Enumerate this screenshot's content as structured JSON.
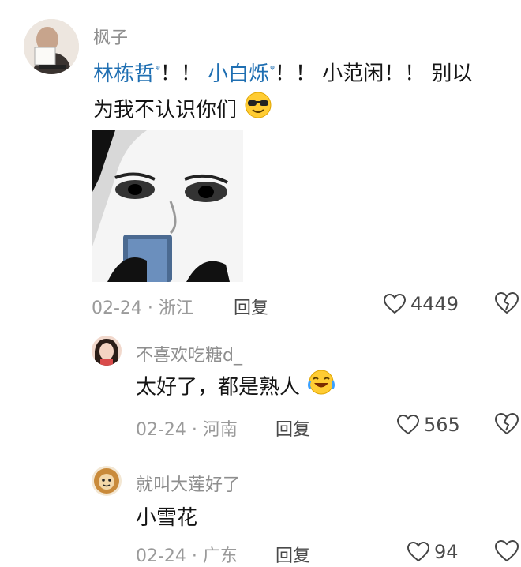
{
  "comment_main": {
    "username": "枫子",
    "mentions": [
      "林栋哲",
      "小白烁"
    ],
    "seg_exclaim_1": "！！",
    "seg_exclaim_2": "！！",
    "seg_plain_1": "小范闲！！ 别以",
    "line2": "为我不认识你们",
    "emoji": "sunglasses-emoji",
    "meta": "02-24 · 浙江",
    "reply_label": "回复",
    "likes": "4449"
  },
  "reply_1": {
    "username": "不喜欢吃糖d_",
    "text": "太好了，都是熟人",
    "emoji": "laugh-cry-emoji",
    "meta": "02-24 · 河南",
    "reply_label": "回复",
    "likes": "565"
  },
  "reply_2": {
    "username": "就叫大莲好了",
    "text": "小雪花",
    "meta_partial": "02-24 · 广东",
    "reply_label_partial": "回复",
    "likes_partial": "94"
  },
  "colors": {
    "mention": "#1f6fb2",
    "username": "#8e8e8e",
    "meta": "#9a9a9a"
  }
}
